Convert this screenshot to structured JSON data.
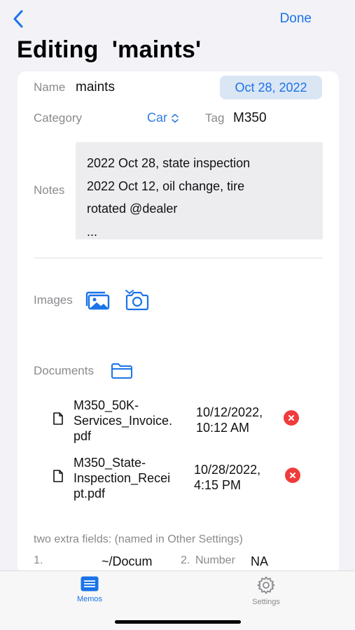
{
  "nav": {
    "done_label": "Done"
  },
  "page": {
    "title": "Editing  'maints'"
  },
  "form": {
    "name_label": "Name",
    "name_value": "maints",
    "date_value": "Oct 28, 2022",
    "category_label": "Category",
    "category_value": "Car",
    "tag_label": "Tag",
    "tag_value": "M350",
    "notes_label": "Notes",
    "notes_lines": [
      "2022 Oct 28, state inspection",
      "2022 Oct 12, oil change, tire",
      "rotated @dealer",
      "..."
    ],
    "images_label": "Images",
    "documents_label": "Documents",
    "documents": [
      {
        "name_lines": [
          "M350_50K-",
          "Services_Invoice.",
          "pdf"
        ],
        "date_lines": [
          "10/12/2022,",
          "10:12 AM"
        ]
      },
      {
        "name_lines": [
          "M350_State-",
          "Inspection_Recei",
          "pt.pdf"
        ],
        "date_lines": [
          "10/28/2022,",
          "4:15 PM"
        ]
      }
    ],
    "extra_fields_title": "two extra fields: (named in Other Settings)",
    "extra_row": {
      "index1": "1.",
      "value1": "~/Docum",
      "index2": "2.",
      "label2": "Number",
      "value2": "NA"
    }
  },
  "tabbar": {
    "tabs": [
      {
        "label": "Memos",
        "icon": "memos-icon",
        "active": true
      },
      {
        "label": "Settings",
        "icon": "gear-icon",
        "active": false
      }
    ]
  },
  "colors": {
    "accent": "#1a73e8",
    "delete": "#ef3b3b",
    "label_gray": "#8a8a8e"
  }
}
